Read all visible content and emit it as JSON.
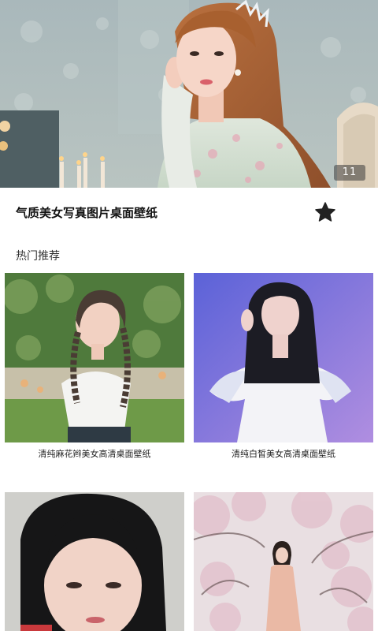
{
  "hero": {
    "image_count": "11",
    "album_title": "气质美女写真图片桌面壁纸"
  },
  "favorite": {
    "icon": "star-icon",
    "color": "#222222"
  },
  "section": {
    "label": "热门推荐"
  },
  "recommendations": [
    {
      "caption": "清纯麻花辫美女高清桌面壁纸"
    },
    {
      "caption": "清纯白皙美女高清桌面壁纸"
    },
    {
      "caption": ""
    },
    {
      "caption": ""
    }
  ]
}
